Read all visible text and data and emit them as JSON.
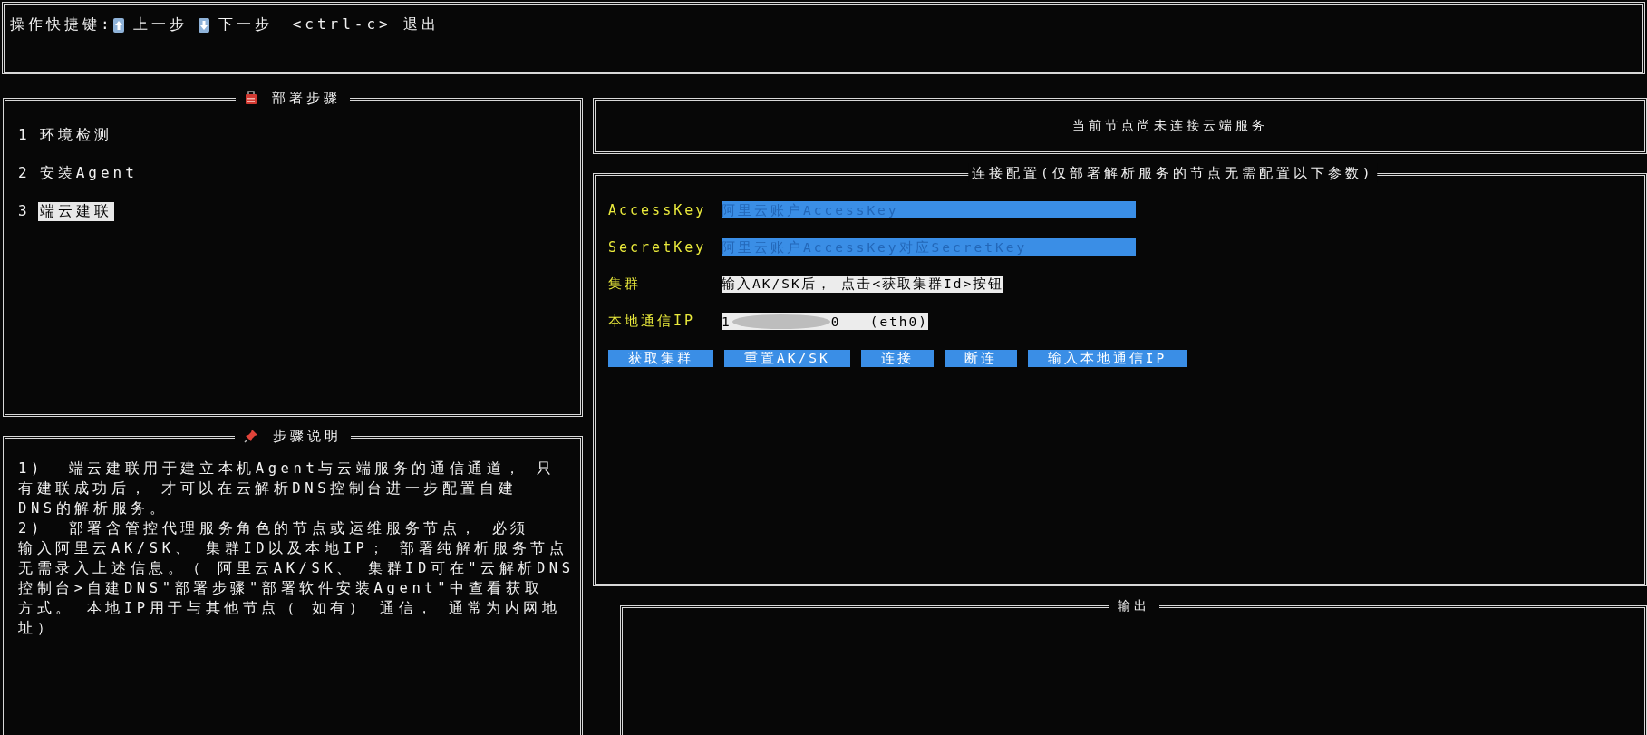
{
  "shortcut_bar": {
    "label": "操作快捷键:",
    "items": [
      {
        "kind": "up",
        "text": "上一步"
      },
      {
        "kind": "down",
        "text": "下一步"
      }
    ],
    "exit": "<ctrl-c> 退出"
  },
  "steps_panel": {
    "title": "部署步骤",
    "items": [
      {
        "number": "1",
        "label": "环境检测",
        "selected": false
      },
      {
        "number": "2",
        "label": "安装Agent",
        "selected": false
      },
      {
        "number": "3",
        "label": "端云建联",
        "selected": true
      }
    ]
  },
  "help_panel": {
    "title": "步骤说明",
    "lines": [
      "1)  端云建联用于建立本机Agent与云端服务的通信通道， 只",
      "有建联成功后， 才可以在云解析DNS控制台进一步配置自建",
      "DNS的解析服务。",
      "2)  部署含管控代理服务角色的节点或运维服务节点， 必须",
      "输入阿里云AK/SK、 集群ID以及本地IP； 部署纯解析服务节点",
      "无需录入上述信息。（ 阿里云AK/SK、 集群ID可在\"云解析DNS",
      "控制台>自建DNS\"部署步骤\"部署软件安装Agent\"中查看获取",
      "方式。 本地IP用于与其他节点（ 如有） 通信， 通常为内网地",
      "址）"
    ]
  },
  "status": {
    "text": "当前节点尚未连接云端服务"
  },
  "config_panel": {
    "title": "连接配置(仅部署解析服务的节点无需配置以下参数)",
    "fields": [
      {
        "kind": "input",
        "label": "AccessKey",
        "placeholder": "阿里云账户AccessKey"
      },
      {
        "kind": "input",
        "label": "SecretKey",
        "placeholder": "阿里云账户AccessKey对应SecretKey"
      },
      {
        "kind": "display",
        "label": "集群",
        "value": "输入AK/SK后， 点击<获取集群Id>按钮"
      },
      {
        "kind": "redacted",
        "label": "本地通信IP",
        "value_start": "1",
        "value_end": "0   (eth0)"
      }
    ],
    "buttons": [
      "获取集群",
      "重置AK/SK",
      "连接",
      "断连",
      "输入本地通信IP"
    ]
  },
  "output_panel": {
    "title": "输出"
  }
}
